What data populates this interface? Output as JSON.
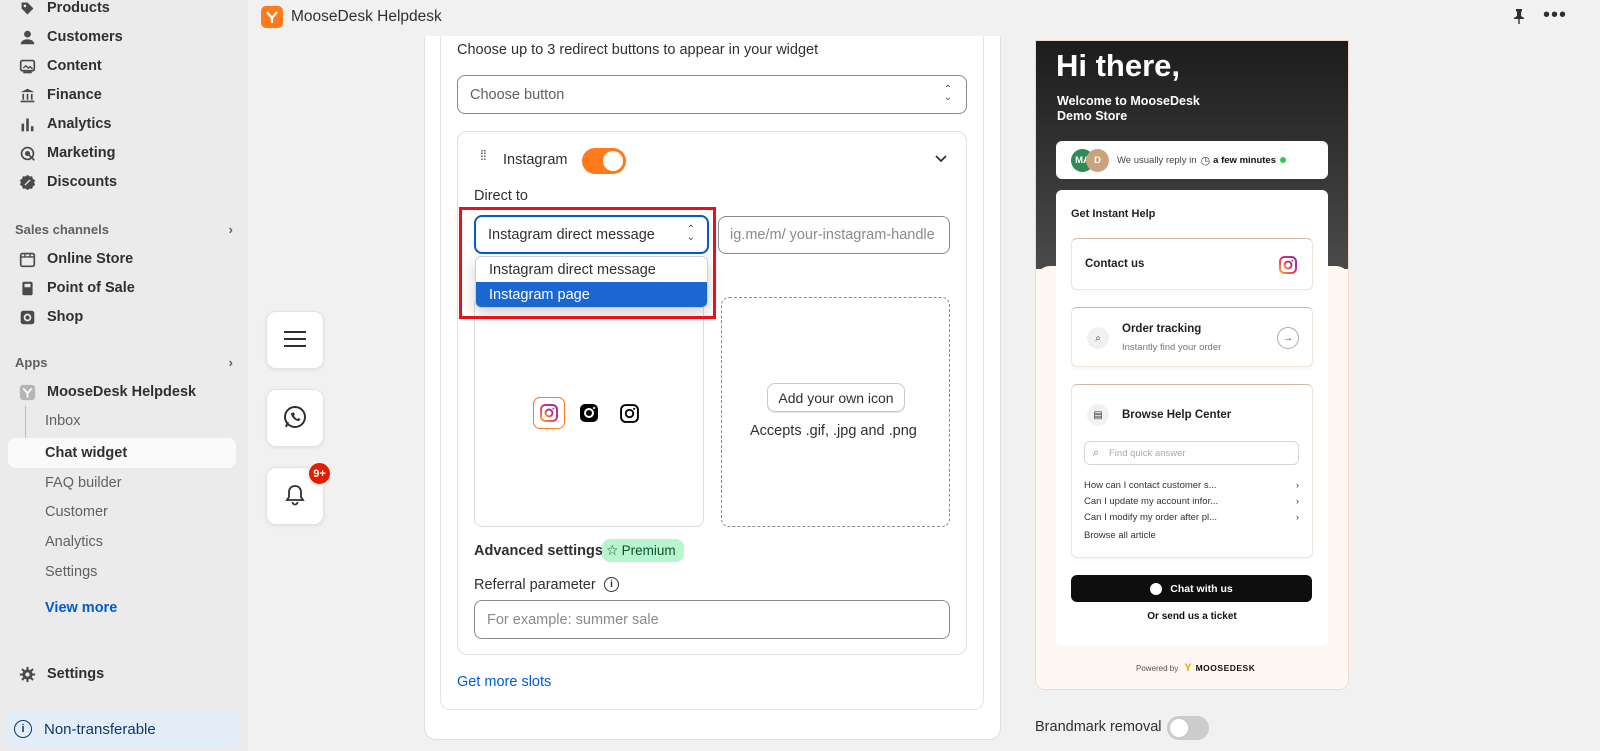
{
  "sidebar": {
    "top_items": [
      {
        "label": "Products",
        "icon": "tag-icon"
      },
      {
        "label": "Customers",
        "icon": "person-icon"
      },
      {
        "label": "Content",
        "icon": "image-icon"
      },
      {
        "label": "Finance",
        "icon": "bank-icon"
      },
      {
        "label": "Analytics",
        "icon": "bar-chart-icon"
      },
      {
        "label": "Marketing",
        "icon": "target-icon"
      },
      {
        "label": "Discounts",
        "icon": "discount-icon"
      }
    ],
    "sales_channels_heading": "Sales channels",
    "sales_channels": [
      {
        "label": "Online Store",
        "icon": "store-icon"
      },
      {
        "label": "Point of Sale",
        "icon": "pos-icon"
      },
      {
        "label": "Shop",
        "icon": "shop-icon"
      }
    ],
    "apps_heading": "Apps",
    "app_name": "MooseDesk Helpdesk",
    "app_subitems": [
      "Inbox",
      "Chat widget",
      "FAQ builder",
      "Customer",
      "Analytics",
      "Settings"
    ],
    "active_subitem": "Chat widget",
    "view_more": "View more",
    "settings": "Settings",
    "non_transferable": "Non-transferable"
  },
  "topbar": {
    "title": "MooseDesk Helpdesk"
  },
  "floating": {
    "badge": "9+"
  },
  "editor": {
    "intro": "Choose up to 3 redirect buttons to appear in your widget",
    "choose_button_placeholder": "Choose button",
    "slot_title": "Instagram",
    "slot_enabled": true,
    "direct_to_label": "Direct to",
    "direct_to_value": "Instagram direct message",
    "handle_placeholder": "ig.me/m/  your-instagram-handle",
    "dropdown_options": [
      "Instagram direct message",
      "Instagram page"
    ],
    "dropdown_highlighted": "Instagram page",
    "add_icon_button": "Add your own icon",
    "accepts_text": "Accepts .gif, .jpg and .png",
    "advanced_settings": "Advanced settings",
    "premium_badge": "Premium",
    "referral_label": "Referral parameter",
    "referral_placeholder": "For example: summer sale",
    "get_more_slots": "Get more slots"
  },
  "preview": {
    "greeting": "Hi there,",
    "welcome_line1": "Welcome to MooseDesk",
    "welcome_line2": "Demo Store",
    "avatar1": "MA",
    "avatar2": "D",
    "reply_text": "We usually reply in",
    "reply_time": "a few minutes",
    "get_instant_help": "Get Instant Help",
    "contact_us": "Contact us",
    "order_tracking": "Order tracking",
    "order_tracking_sub": "Instantly find your order",
    "browse_help_center": "Browse Help Center",
    "search_placeholder": "Find quick answer",
    "questions": [
      "How can I contact customer s...",
      "Can I update my account infor...",
      "Can I modify my order after pl..."
    ],
    "browse_all": "Browse all article",
    "chat_with_us": "Chat with us",
    "send_ticket": "Or send us a ticket",
    "powered_by": "Powered by",
    "brand": "MOOSEDESK"
  },
  "brandmark": {
    "label": "Brandmark removal",
    "enabled": false
  },
  "colors": {
    "accent": "#ff7a1a",
    "link": "#005bd3",
    "highlight_outline": "#e8111b",
    "selected_option": "#1a67d2"
  }
}
